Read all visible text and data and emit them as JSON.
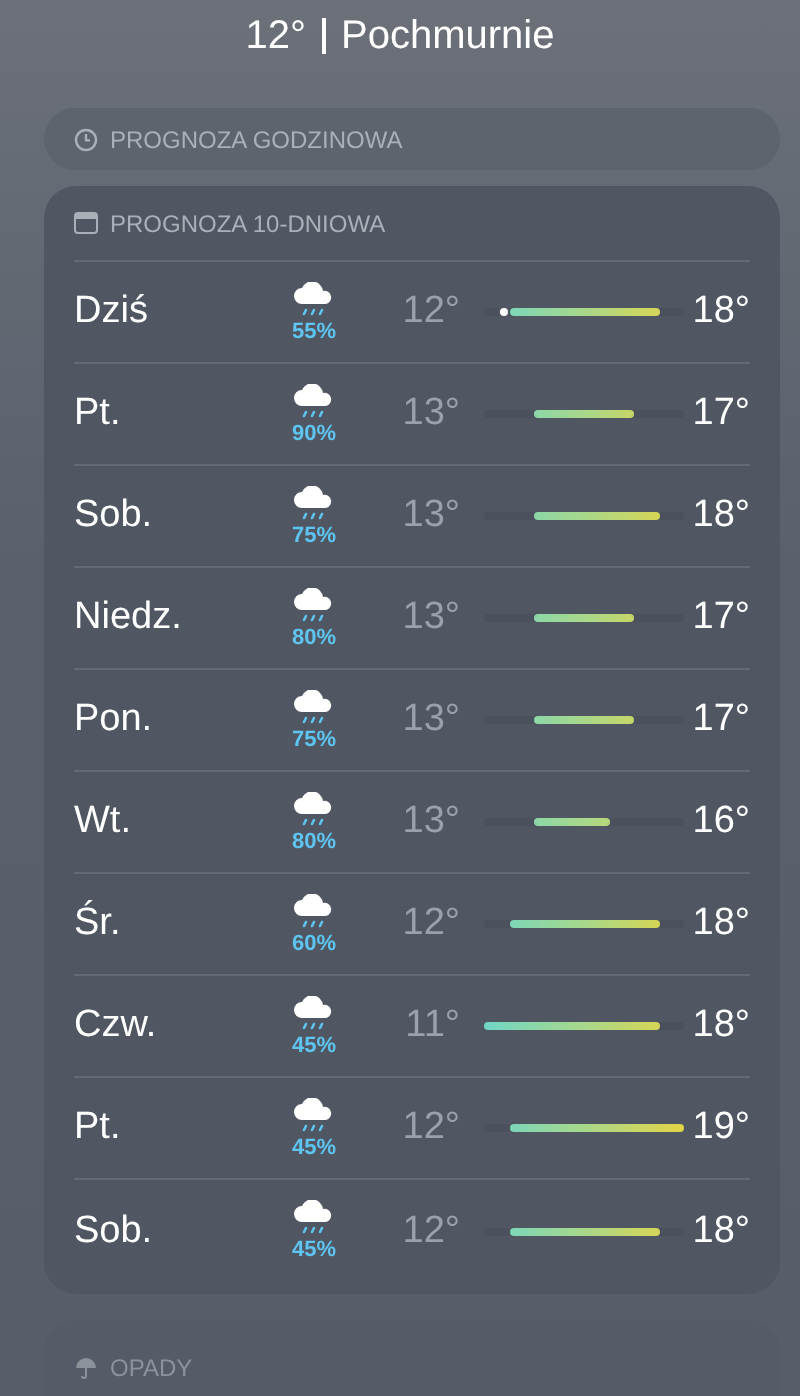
{
  "header": {
    "temperature": "12°",
    "condition": "Pochmurnie"
  },
  "hourly_card": {
    "title": "PROGNOZA GODZINOWA"
  },
  "daily_card": {
    "title": "PROGNOZA 10-DNIOWA",
    "days": [
      {
        "day": "Dziś",
        "precip": "55%",
        "low": "12°",
        "high": "18°",
        "current": true
      },
      {
        "day": "Pt.",
        "precip": "90%",
        "low": "13°",
        "high": "17°",
        "current": false
      },
      {
        "day": "Sob.",
        "precip": "75%",
        "low": "13°",
        "high": "18°",
        "current": false
      },
      {
        "day": "Niedz.",
        "precip": "80%",
        "low": "13°",
        "high": "17°",
        "current": false
      },
      {
        "day": "Pon.",
        "precip": "75%",
        "low": "13°",
        "high": "17°",
        "current": false
      },
      {
        "day": "Wt.",
        "precip": "80%",
        "low": "13°",
        "high": "16°",
        "current": false
      },
      {
        "day": "Śr.",
        "precip": "60%",
        "low": "12°",
        "high": "18°",
        "current": false
      },
      {
        "day": "Czw.",
        "precip": "45%",
        "low": "11°",
        "high": "18°",
        "current": false
      },
      {
        "day": "Pt.",
        "precip": "45%",
        "low": "12°",
        "high": "19°",
        "current": false
      },
      {
        "day": "Sob.",
        "precip": "45%",
        "low": "12°",
        "high": "18°",
        "current": false
      }
    ]
  },
  "precip_card": {
    "title": "OPADY"
  }
}
